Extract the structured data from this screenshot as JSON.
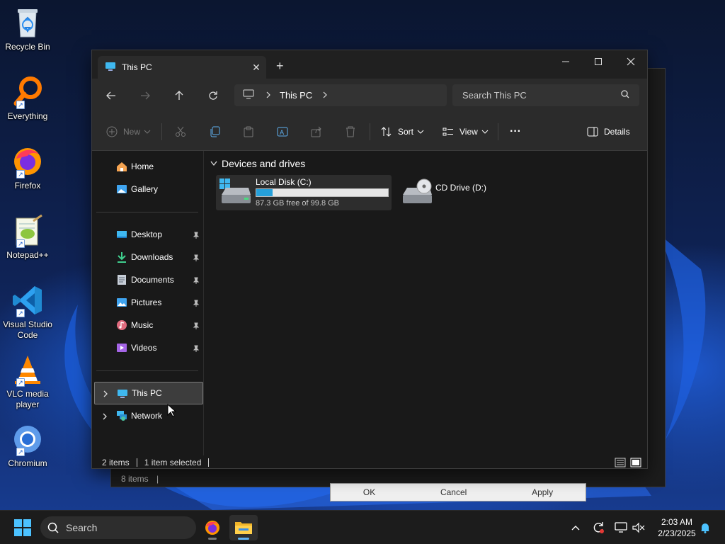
{
  "desktop": {
    "icons": [
      {
        "label": "Recycle Bin",
        "icon": "recycle-bin-icon"
      },
      {
        "label": "Everything",
        "icon": "everything-icon"
      },
      {
        "label": "Firefox",
        "icon": "firefox-icon"
      },
      {
        "label": "Notepad++",
        "icon": "notepadpp-icon"
      },
      {
        "label": "Visual Studio Code",
        "icon": "vscode-icon"
      },
      {
        "label": "VLC media player",
        "icon": "vlc-icon"
      },
      {
        "label": "Chromium",
        "icon": "chromium-icon"
      }
    ]
  },
  "background_window": {
    "status": "8 items",
    "buttons": [
      "OK",
      "Cancel",
      "Apply"
    ]
  },
  "explorer": {
    "tab_title": "This PC",
    "new_tab_symbol": "+",
    "breadcrumb": "This PC",
    "search_placeholder": "Search This PC",
    "toolbar": {
      "new_label": "New",
      "sort_label": "Sort",
      "view_label": "View",
      "more_label": "···",
      "details_label": "Details"
    },
    "sidebar": {
      "home": "Home",
      "gallery": "Gallery",
      "pinned": [
        "Desktop",
        "Downloads",
        "Documents",
        "Pictures",
        "Music",
        "Videos"
      ],
      "this_pc": "This PC",
      "network": "Network"
    },
    "content": {
      "group_header": "Devices and drives",
      "drives": [
        {
          "name": "Local Disk (C:)",
          "free_text": "87.3 GB free of 99.8 GB",
          "used_fraction": 0.125
        },
        {
          "name": "CD Drive (D:)"
        }
      ]
    },
    "status": {
      "items": "2 items",
      "selected": "1 item selected"
    }
  },
  "taskbar": {
    "search_placeholder": "Search",
    "time": "2:03 AM",
    "date": "2/23/2025"
  },
  "colors": {
    "accent": "#4cc2ff",
    "progress_fill": "#26a0da",
    "window_bg": "#191919"
  }
}
